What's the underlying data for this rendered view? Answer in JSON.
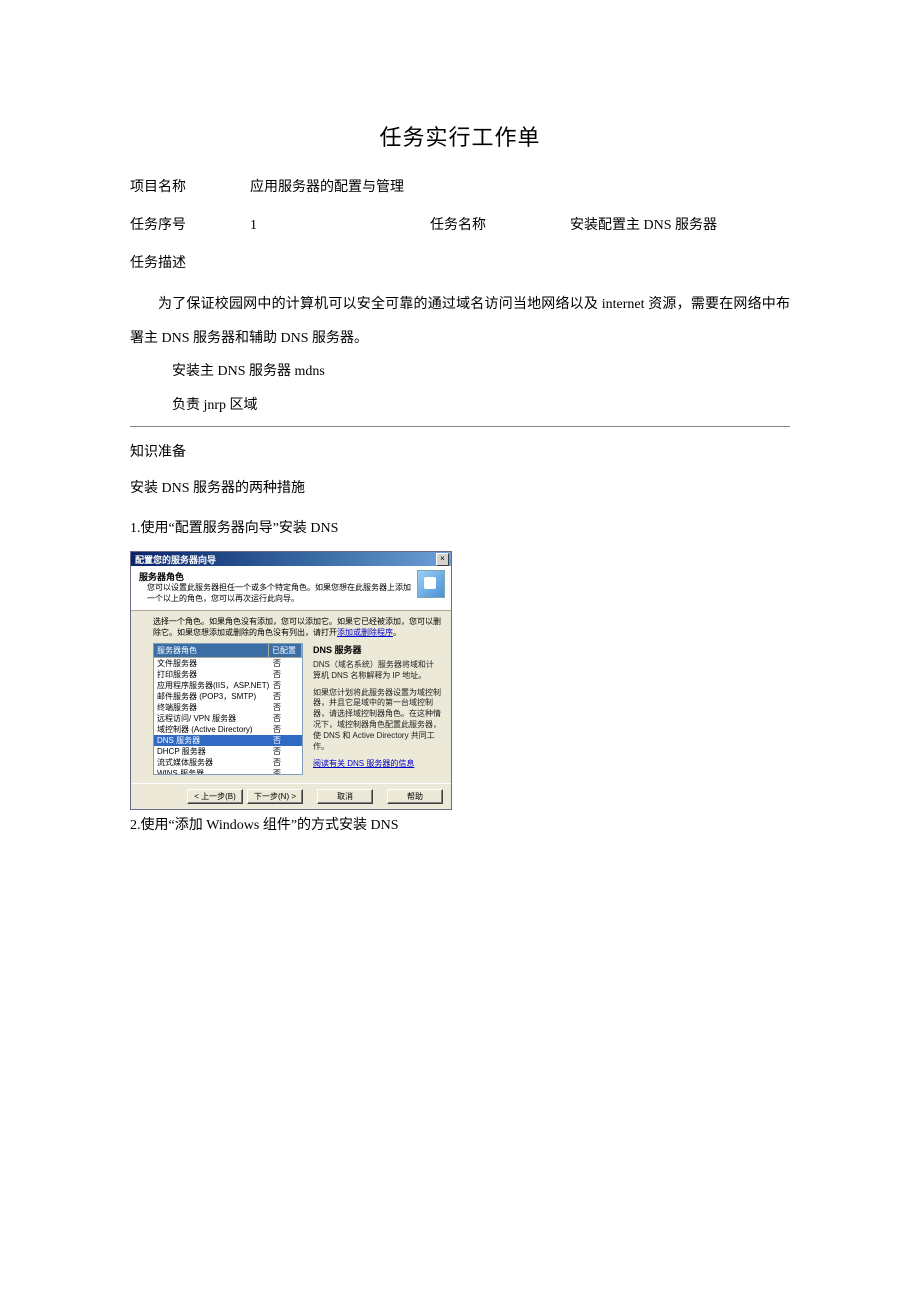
{
  "doc": {
    "title": "任务实行工作单",
    "project_label": "项目名称",
    "project_value": "应用服务器的配置与管理",
    "seq_label": "任务序号",
    "seq_value": "1",
    "task_name_label": "任务名称",
    "task_name_value": "安装配置主 DNS 服务器",
    "desc_label": "任务描述",
    "desc_p1": "为了保证校园网中的计算机可以安全可靠的通过域名访问当地网络以及 internet 资源，需要在网络中布署主 DNS 服务器和辅助 DNS 服务器。",
    "desc_p2": "安装主 DNS 服务器 mdns",
    "desc_p3": "负责 jnrp 区域",
    "prep_label": "知识准备",
    "methods_intro": "安装 DNS 服务器的两种措施",
    "step1": "1.使用“配置服务器向导”安装 DNS",
    "step2": "2.使用“添加 Windows 组件”的方式安装 DNS"
  },
  "wizard": {
    "titlebar": "配置您的服务器向导",
    "close": "×",
    "header_title": "服务器角色",
    "header_sub": "您可以设置此服务器担任一个或多个特定角色。如果您想在此服务器上添加一个以上的角色，您可以再次运行此向导。",
    "instr_pre": "选择一个角色。如果角色没有添加，您可以添加它。如果它已经被添加，您可以删除它。如果您想添加或删除的角色没有列出，请打开",
    "instr_link": "添加或删除程序",
    "instr_post": "。",
    "col_role": "服务器角色",
    "col_conf": "已配置",
    "roles": [
      {
        "name": "文件服务器",
        "conf": "否"
      },
      {
        "name": "打印服务器",
        "conf": "否"
      },
      {
        "name": "应用程序服务器(IIS，ASP.NET)",
        "conf": "否"
      },
      {
        "name": "邮件服务器 (POP3，SMTP)",
        "conf": "否"
      },
      {
        "name": "终端服务器",
        "conf": "否"
      },
      {
        "name": "远程访问/ VPN 服务器",
        "conf": "否"
      },
      {
        "name": "域控制器 (Active Directory)",
        "conf": "否"
      },
      {
        "name": "DNS 服务器",
        "conf": "否",
        "selected": true
      },
      {
        "name": "DHCP 服务器",
        "conf": "否"
      },
      {
        "name": "流式媒体服务器",
        "conf": "否"
      },
      {
        "name": "WINS 服务器",
        "conf": "否"
      }
    ],
    "desc_title": "DNS 服务器",
    "desc_p1": "DNS（域名系统）服务器将域和计算机 DNS 名称解释为 IP 地址。",
    "desc_p2": "如果您计划将此服务器设置为域控制器，并且它是域中的第一台域控制器，请选择域控制器角色。在这种情况下，域控制器角色配置此服务器，使 DNS 和 Active Directory 共同工作。",
    "desc_link": "阅读有关 DNS 服务器的信息",
    "btn_back": "< 上一步(B)",
    "btn_next": "下一步(N) >",
    "btn_cancel": "取消",
    "btn_help": "帮助"
  }
}
